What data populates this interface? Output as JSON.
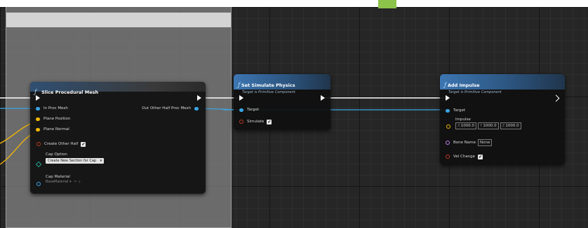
{
  "nodes": {
    "slice": {
      "title": "Slice Procedural Mesh",
      "inputs": {
        "in_proc_mesh": "In Proc Mesh",
        "plane_position": "Plane Position",
        "plane_normal": "Plane Normal",
        "create_other_half": "Create Other Half",
        "cap_option": "Cap Option",
        "cap_option_value": "Create New Section for Cap",
        "cap_material": "Cap Material",
        "cap_material_value": "BaseMaterial"
      },
      "outputs": {
        "out_other_half": "Out Other Half Proc Mesh"
      }
    },
    "set_simulate": {
      "title": "Set Simulate Physics",
      "subtitle": "Target is Primitive Component",
      "inputs": {
        "target": "Target",
        "simulate": "Simulate"
      }
    },
    "add_impulse": {
      "title": "Add Impulse",
      "subtitle": "Target is Primitive Component",
      "inputs": {
        "target": "Target",
        "impulse": "Impulse",
        "x_label": "X",
        "x_value": "1000.0",
        "y_label": "Y",
        "y_value": "1000.0",
        "z_label": "Z",
        "z_value": "1000.0",
        "bone_name": "Bone Name",
        "bone_name_value": "None",
        "vel_change": "Vel Change"
      }
    }
  },
  "colors": {
    "exec": "#ffffff",
    "object_pin": "#3aa6e6",
    "vector_pin": "#f2b705",
    "bool_pin": "#c2381f",
    "enum_pin": "#1fa58e",
    "name_pin": "#c07cf2"
  },
  "icons": {
    "function": "f-function-icon",
    "checkbox": "checkbox-checked-icon",
    "dropdown": "chevron-down-icon",
    "use_asset": "arrow-left-icon",
    "browse_asset": "magnifier-icon"
  },
  "glyphs": {
    "function": "ƒ",
    "check": "✔",
    "dropdown": "▾",
    "use_asset": "⇦",
    "browse": "⌕"
  }
}
